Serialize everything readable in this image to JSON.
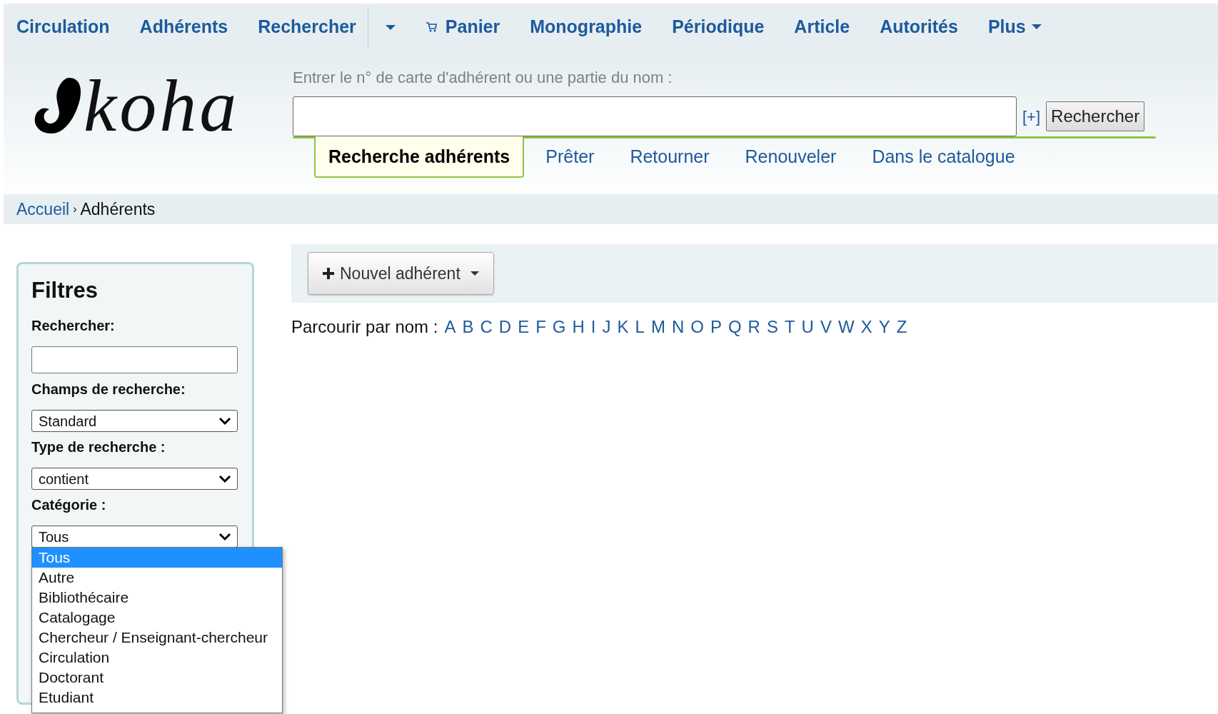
{
  "nav": [
    {
      "kind": "link",
      "label": "Circulation"
    },
    {
      "kind": "link",
      "label": "Adhérents"
    },
    {
      "kind": "split",
      "label": "Rechercher"
    },
    {
      "kind": "cart",
      "label": "Panier"
    },
    {
      "kind": "link",
      "label": "Monographie"
    },
    {
      "kind": "link",
      "label": "Périodique"
    },
    {
      "kind": "link",
      "label": "Article"
    },
    {
      "kind": "link",
      "label": "Autorités"
    },
    {
      "kind": "menu",
      "label": "Plus"
    }
  ],
  "logo": {
    "text": "koha"
  },
  "search": {
    "label": "Entrer le n° de carte d'adhérent ou une partie du nom :",
    "more": "[+]",
    "button": "Rechercher"
  },
  "tabs": [
    {
      "label": "Recherche adhérents",
      "selected": true
    },
    {
      "label": "Prêter",
      "selected": false
    },
    {
      "label": "Retourner",
      "selected": false
    },
    {
      "label": "Renouveler",
      "selected": false
    },
    {
      "label": "Dans le catalogue",
      "selected": false
    }
  ],
  "breadcrumb": {
    "separator": "›",
    "items": [
      {
        "kind": "link",
        "label": "Accueil"
      },
      {
        "kind": "current",
        "label": "Adhérents"
      }
    ]
  },
  "filters": {
    "title": "Filtres",
    "fields": [
      {
        "kind": "text",
        "label": "Rechercher:"
      },
      {
        "kind": "select",
        "label": "Champs de recherche:",
        "value": "Standard"
      },
      {
        "kind": "select",
        "label": "Type de recherche :",
        "value": "contient"
      },
      {
        "kind": "select",
        "label": "Catégorie :",
        "value": "Tous",
        "open": true
      }
    ],
    "options": [
      {
        "label": "Tous",
        "selected": true
      },
      {
        "label": "Autre",
        "selected": false
      },
      {
        "label": "Bibliothécaire",
        "selected": false
      },
      {
        "label": "Catalogage",
        "selected": false
      },
      {
        "label": "Chercheur / Enseignant-chercheur",
        "selected": false
      },
      {
        "label": "Circulation",
        "selected": false
      },
      {
        "label": "Doctorant",
        "selected": false
      },
      {
        "label": "Etudiant",
        "selected": false
      }
    ]
  },
  "toolbar": {
    "button": "Nouvel adhérent"
  },
  "browse": {
    "label": "Parcourir par nom :",
    "letters": [
      "A",
      "B",
      "C",
      "D",
      "E",
      "F",
      "G",
      "H",
      "I",
      "J",
      "K",
      "L",
      "M",
      "N",
      "O",
      "P",
      "Q",
      "R",
      "S",
      "T",
      "U",
      "V",
      "W",
      "X",
      "Y",
      "Z"
    ]
  }
}
